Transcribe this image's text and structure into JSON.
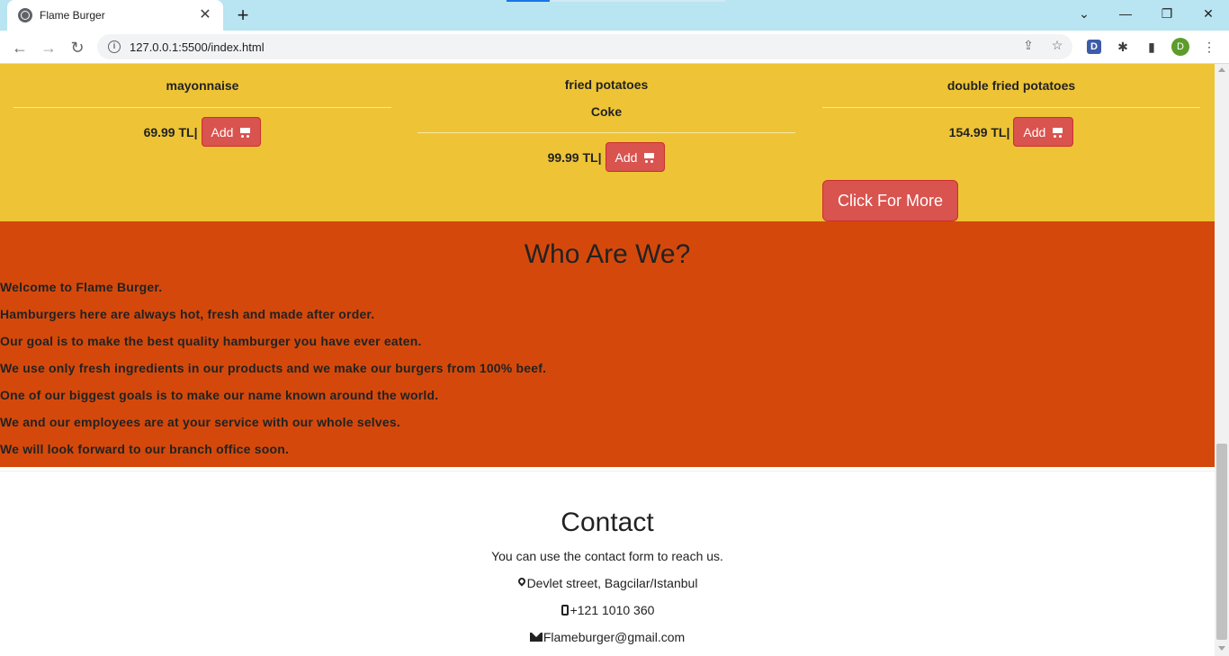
{
  "browser": {
    "tab_title": "Flame Burger",
    "tab_close": "✕",
    "new_tab": "+",
    "url": "127.0.0.1:5500/index.html",
    "window_controls": {
      "list": "⌄",
      "minimize": "—",
      "restore": "❐",
      "close": "✕"
    },
    "nav": {
      "back": "←",
      "forward": "→",
      "reload": "↻"
    },
    "extension_letter": "D",
    "profile_letter": "D"
  },
  "menu": {
    "cards": [
      {
        "items": [
          "mayonnaise"
        ],
        "price": "69.99 TL|",
        "add_label": "Add"
      },
      {
        "items": [
          "fried potatoes",
          "Coke"
        ],
        "price": "99.99 TL|",
        "add_label": "Add"
      },
      {
        "items": [
          "double fried potatoes"
        ],
        "price": "154.99 TL|",
        "add_label": "Add"
      }
    ],
    "more_label": "Click For More"
  },
  "about": {
    "title": "Who Are We?",
    "lines": [
      "Welcome to Flame Burger.",
      "Hamburgers here are always hot, fresh and made after order.",
      "Our goal is to make the best quality hamburger you have ever eaten.",
      "We use only fresh ingredients in our products and we make our burgers from 100% beef.",
      "One of our biggest goals is to make our name known around the world.",
      "We and our employees are at your service with our whole selves.",
      "We will look forward to our branch office soon."
    ]
  },
  "contact": {
    "title": "Contact",
    "subtitle": "You can use the contact form to reach us.",
    "address": "Devlet street, Bagcilar/Istanbul",
    "phone": "+121 1010 360",
    "email": "Flameburger@gmail.com"
  },
  "colors": {
    "menu_bg": "#eec436",
    "about_bg": "#d4490b",
    "button": "#d9534f"
  }
}
